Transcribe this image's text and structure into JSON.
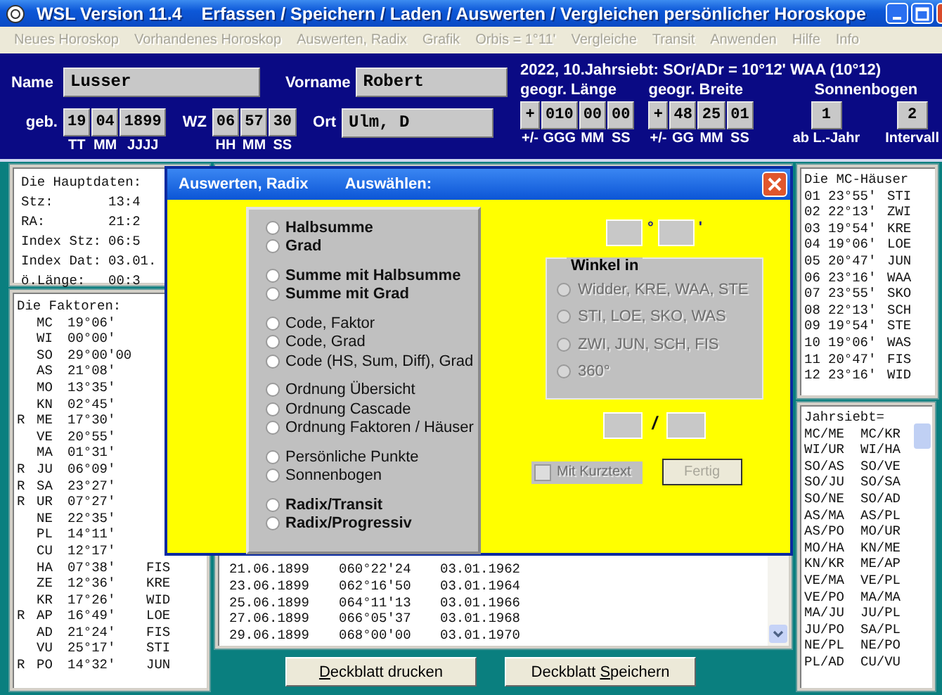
{
  "window": {
    "title": "WSL Version 11.4",
    "subtitle": "Erfassen / Speichern / Laden / Auswerten / Vergleichen persönlicher Horoskope"
  },
  "menu": [
    {
      "label": "Neues Horoskop",
      "disabled": true
    },
    {
      "label": "Vorhandenes Horoskop",
      "disabled": true
    },
    {
      "label": "Auswerten, Radix",
      "disabled": true
    },
    {
      "label": "Grafik",
      "disabled": true
    },
    {
      "label": "Orbis = 1°11'",
      "disabled": true
    },
    {
      "label": "Vergleiche",
      "disabled": true
    },
    {
      "label": "Transit",
      "disabled": true
    },
    {
      "label": "Anwenden",
      "disabled": true
    },
    {
      "label": "Hilfe",
      "disabled": true
    },
    {
      "label": "Info",
      "disabled": true
    }
  ],
  "person": {
    "name_label": "Name",
    "name": "Lusser",
    "vorname_label": "Vorname",
    "vorname": "Robert",
    "geb_label": "geb.",
    "geb": [
      {
        "value": "19",
        "unit": "TT"
      },
      {
        "value": "04",
        "unit": "MM"
      },
      {
        "value": "1899",
        "unit": "JJJJ"
      }
    ],
    "wz_label": "WZ",
    "wz": [
      {
        "value": "06",
        "unit": "HH"
      },
      {
        "value": "57",
        "unit": "MM"
      },
      {
        "value": "30",
        "unit": "SS"
      }
    ],
    "ort_label": "Ort",
    "ort": "Ulm, D"
  },
  "jahrsiebt_info": "2022, 10.Jahrsiebt: SOr/ADr = 10°12' WAA (10°12)",
  "coords": [
    {
      "title": "geogr. Länge",
      "fields": [
        {
          "value": "+",
          "unit": "+/-"
        },
        {
          "value": "010",
          "unit": "GGG"
        },
        {
          "value": "00",
          "unit": "MM"
        },
        {
          "value": "00",
          "unit": "SS"
        }
      ]
    },
    {
      "title": "geogr. Breite",
      "fields": [
        {
          "value": "+",
          "unit": "+/-"
        },
        {
          "value": "48",
          "unit": "GG"
        },
        {
          "value": "25",
          "unit": "MM"
        },
        {
          "value": "01",
          "unit": "SS"
        }
      ]
    }
  ],
  "sonnenbogen": {
    "title": "Sonnenbogen",
    "fields": [
      {
        "value": "1",
        "unit": "ab L.-Jahr"
      },
      {
        "value": "2",
        "unit": "Intervall"
      }
    ]
  },
  "hauptdaten": {
    "title": "Die Hauptdaten:",
    "rows": [
      {
        "label": "Stz:",
        "value": "13:4"
      },
      {
        "label": "RA:",
        "value": "21:2"
      },
      {
        "label": "Index Stz:",
        "value": "06:5"
      },
      {
        "label": "Index Dat:",
        "value": "03.01."
      },
      {
        "label": "ö.Länge:",
        "value": "00:3"
      }
    ]
  },
  "faktoren": {
    "title": "Die Faktoren:",
    "rows": [
      {
        "code": "MC",
        "degree": "19°06'"
      },
      {
        "code": "WI",
        "degree": "00°00'"
      },
      {
        "code": "SO",
        "degree": "29°00'00"
      },
      {
        "code": "AS",
        "degree": "21°08'"
      },
      {
        "code": "MO",
        "degree": "13°35'"
      },
      {
        "code": "KN",
        "degree": "02°45'"
      },
      {
        "flag": "R",
        "code": "ME",
        "degree": "17°30'"
      },
      {
        "code": "VE",
        "degree": "20°55'"
      },
      {
        "code": "MA",
        "degree": "01°31'"
      },
      {
        "flag": "R",
        "code": "JU",
        "degree": "06°09'"
      },
      {
        "flag": "R",
        "code": "SA",
        "degree": "23°27'"
      },
      {
        "flag": "R",
        "code": "UR",
        "degree": "07°27'"
      },
      {
        "code": "NE",
        "degree": "22°35'"
      },
      {
        "code": "PL",
        "degree": "14°11'"
      },
      {
        "code": "CU",
        "degree": "12°17'"
      },
      {
        "code": "HA",
        "degree": "07°38'",
        "sign": "FIS"
      },
      {
        "code": "ZE",
        "degree": "12°36'",
        "sign": "KRE"
      },
      {
        "code": "KR",
        "degree": "17°26'",
        "sign": "WID"
      },
      {
        "flag": "R",
        "code": "AP",
        "degree": "16°49'",
        "sign": "LOE"
      },
      {
        "code": "AD",
        "degree": "21°24'",
        "sign": "FIS"
      },
      {
        "code": "VU",
        "degree": "25°17'",
        "sign": "STI"
      },
      {
        "flag": "R",
        "code": "PO",
        "degree": "14°32'",
        "sign": "JUN"
      }
    ]
  },
  "progression": {
    "rows": [
      {
        "date": "21.06.1899",
        "arc": "060°22'24",
        "target": "03.01.1962"
      },
      {
        "date": "23.06.1899",
        "arc": "062°16'50",
        "target": "03.01.1964"
      },
      {
        "date": "25.06.1899",
        "arc": "064°11'13",
        "target": "03.01.1966"
      },
      {
        "date": "27.06.1899",
        "arc": "066°05'37",
        "target": "03.01.1968"
      },
      {
        "date": "29.06.1899",
        "arc": "068°00'00",
        "target": "03.01.1970"
      }
    ]
  },
  "buttons": [
    {
      "mnemonic": "D",
      "rest": "eckblatt drucken"
    },
    {
      "prefix": "Deckblatt ",
      "mnemonic": "S",
      "rest": "peichern"
    }
  ],
  "mc_haeuser": {
    "title": "Die MC-Häuser",
    "rows": [
      {
        "house": "01",
        "degree": "23°55'",
        "sign": "STI"
      },
      {
        "house": "02",
        "degree": "22°13'",
        "sign": "ZWI"
      },
      {
        "house": "03",
        "degree": "19°54'",
        "sign": "KRE"
      },
      {
        "house": "04",
        "degree": "19°06'",
        "sign": "LOE"
      },
      {
        "house": "05",
        "degree": "20°47'",
        "sign": "JUN"
      },
      {
        "house": "06",
        "degree": "23°16'",
        "sign": "WAA"
      },
      {
        "house": "07",
        "degree": "23°55'",
        "sign": "SKO"
      },
      {
        "house": "08",
        "degree": "22°13'",
        "sign": "SCH"
      },
      {
        "house": "09",
        "degree": "19°54'",
        "sign": "STE"
      },
      {
        "house": "10",
        "degree": "19°06'",
        "sign": "WAS"
      },
      {
        "house": "11",
        "degree": "20°47'",
        "sign": "FIS"
      },
      {
        "house": "12",
        "degree": "23°16'",
        "sign": "WID"
      }
    ]
  },
  "jahrsiebt": {
    "title": "Jahrsiebt=",
    "pairs": [
      [
        "MC/ME",
        "MC/KR"
      ],
      [
        "WI/UR",
        "WI/HA"
      ],
      [
        "SO/AS",
        "SO/VE"
      ],
      [
        "SO/JU",
        "SO/SA"
      ],
      [
        "SO/NE",
        "SO/AD"
      ],
      [
        "AS/MA",
        "AS/PL"
      ],
      [
        "AS/PO",
        "MO/UR"
      ],
      [
        "MO/HA",
        "KN/ME"
      ],
      [
        "KN/KR",
        "ME/AP"
      ],
      [
        "VE/MA",
        "VE/PL"
      ],
      [
        "VE/PO",
        "MA/MA"
      ],
      [
        "MA/JU",
        "JU/PL"
      ],
      [
        "JU/PO",
        "SA/PL"
      ],
      [
        "NE/PL",
        "NE/PO"
      ],
      [
        "PL/AD",
        "CU/VU"
      ]
    ]
  },
  "dialog": {
    "title": "Auswerten, Radix",
    "subtitle": "Auswählen:",
    "groups": [
      {
        "bold": true,
        "options": [
          {
            "label": "Halbsumme",
            "selected": false
          },
          {
            "label": "Grad",
            "selected": false
          }
        ]
      },
      {
        "bold": true,
        "options": [
          {
            "label": "Summe mit Halbsumme",
            "selected": false
          },
          {
            "label": "Summe mit Grad",
            "selected": false
          }
        ]
      },
      {
        "bold": false,
        "options": [
          {
            "label": "Code, Faktor",
            "selected": false
          },
          {
            "label": "Code, Grad",
            "selected": false
          },
          {
            "label": "Code (HS, Sum, Diff), Grad",
            "selected": false
          }
        ]
      },
      {
        "bold": false,
        "options": [
          {
            "label": "Ordnung Übersicht",
            "selected": false
          },
          {
            "label": "Ordnung Cascade",
            "selected": false
          },
          {
            "label": "Ordnung Faktoren / Häuser",
            "selected": false
          }
        ]
      },
      {
        "bold": false,
        "options": [
          {
            "label": "Persönliche Punkte",
            "selected": false
          },
          {
            "label": "Sonnenbogen",
            "selected": false
          }
        ]
      },
      {
        "bold": true,
        "options": [
          {
            "label": "Radix/Transit",
            "selected": false
          },
          {
            "label": "Radix/Progressiv",
            "selected": false
          }
        ]
      }
    ],
    "degree_mark": "°",
    "minute_mark": "'",
    "winkel": {
      "title": "Winkel in",
      "disabled": true,
      "options": [
        {
          "label": "Widder, KRE, WAA, STE",
          "selected": false
        },
        {
          "label": "STI, LOE, SKO, WAS",
          "selected": false
        },
        {
          "label": "ZWI, JUN, SCH, FIS",
          "selected": false
        },
        {
          "label": "360°",
          "selected": false
        }
      ]
    },
    "ratio_separator": "/",
    "kurztext": {
      "label": "Mit Kurztext",
      "checked": false,
      "disabled": true
    },
    "fertig": {
      "label": "Fertig",
      "disabled": true
    }
  }
}
